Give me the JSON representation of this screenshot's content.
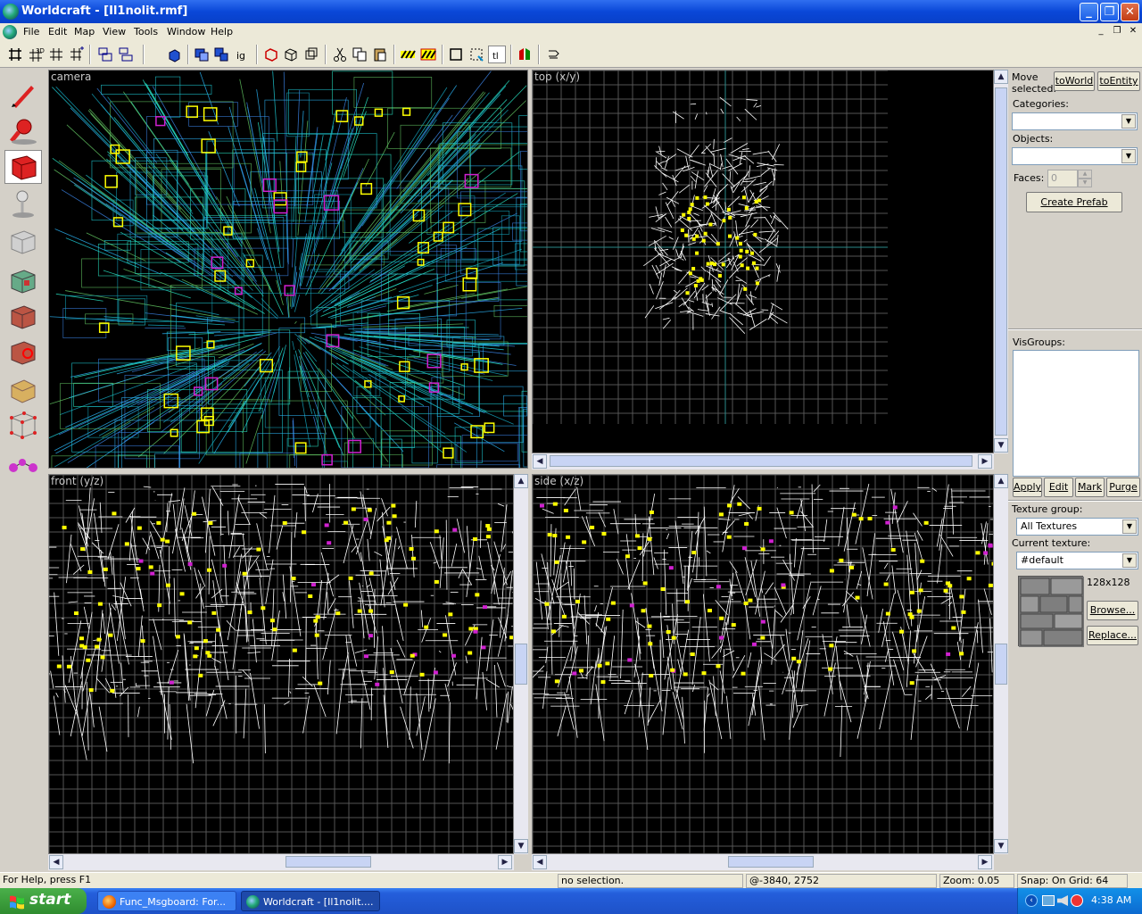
{
  "window": {
    "title": "Worldcraft - [Il1nolit.rmf]"
  },
  "menu": [
    "File",
    "Edit",
    "Map",
    "View",
    "Tools",
    "Window",
    "Help"
  ],
  "viewports": {
    "camera": "camera",
    "top": "top (x/y)",
    "front": "front (y/z)",
    "side": "side (x/z)"
  },
  "right_panel": {
    "move_selected": "Move selected:",
    "to_world": "toWorld",
    "to_entity": "toEntity",
    "categories_label": "Categories:",
    "categories_value": "",
    "objects_label": "Objects:",
    "objects_value": "",
    "faces_label": "Faces:",
    "faces_value": "0",
    "create_prefab": "Create Prefab",
    "visgroups_label": "VisGroups:",
    "apply": "Apply",
    "edit": "Edit",
    "mark": "Mark",
    "purge": "Purge",
    "texture_group_label": "Texture group:",
    "texture_group_value": "All Textures",
    "current_texture_label": "Current texture:",
    "current_texture_value": "#default",
    "texture_size": "128x128",
    "browse": "Browse...",
    "replace": "Replace..."
  },
  "status": {
    "help": "For Help, press F1",
    "selection": "no selection.",
    "coords": "@-3840, 2752",
    "zoom": "Zoom: 0.05",
    "snap": "Snap: On Grid: 64"
  },
  "taskbar": {
    "start": "start",
    "tasks": [
      "Func_Msgboard: For...",
      "Worldcraft - [Il1nolit...."
    ],
    "clock": "4:38 AM"
  },
  "colors": {
    "title_blue": "#0a47d8",
    "taskbar_blue": "#245edb",
    "start_green": "#2f8c2f",
    "wire_cyan": "#1ec8d2",
    "entity_yellow": "#ffff00",
    "entity_magenta": "#d020d0"
  }
}
